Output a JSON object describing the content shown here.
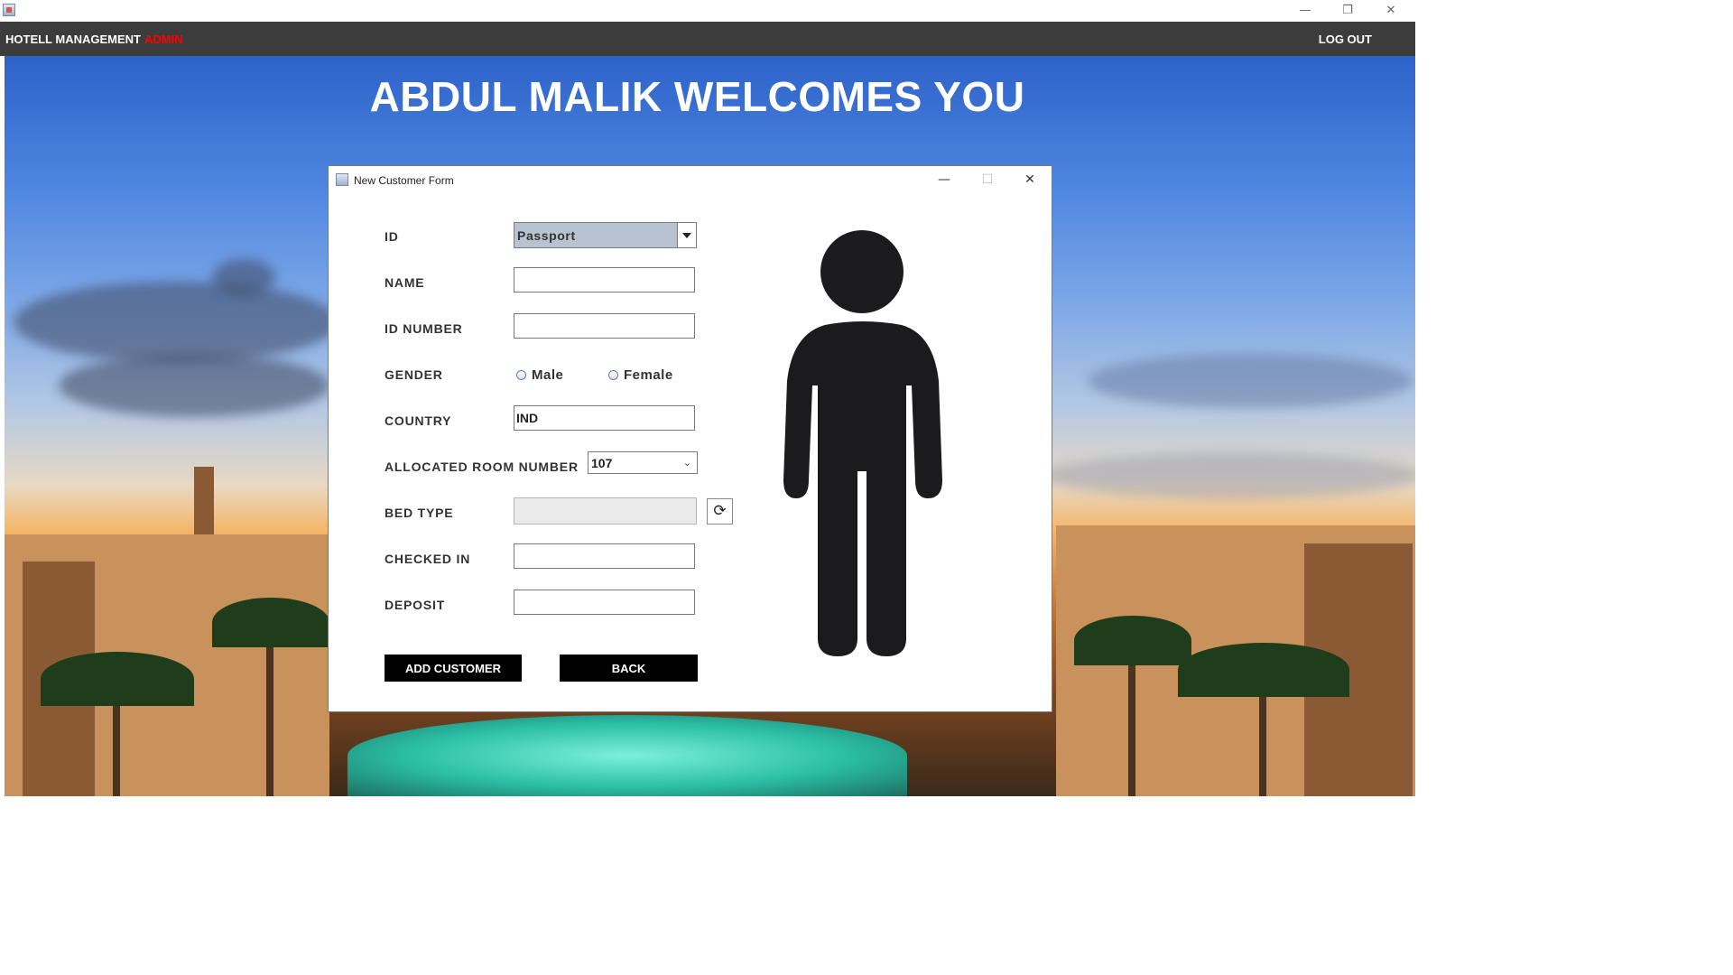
{
  "window": {
    "minimize_glyph": "—",
    "restore_glyph": "❐",
    "close_glyph": "✕"
  },
  "menubar": {
    "title": "HOTELL MANAGEMENT",
    "role": "ADMIN",
    "logout": "LOG OUT"
  },
  "banner": {
    "welcome": "ABDUL MALIK WELCOMES YOU"
  },
  "dialog": {
    "title": "New Customer Form",
    "minimize_glyph": "—",
    "maximize_glyph": "☐",
    "close_glyph": "✕"
  },
  "form": {
    "id_label": "ID",
    "id_value": "Passport",
    "name_label": "NAME",
    "name_value": "",
    "id_number_label": "ID NUMBER",
    "id_number_value": "",
    "gender_label": "GENDER",
    "gender_options": [
      "Male",
      "Female"
    ],
    "country_label": "COUNTRY",
    "country_value": "IND",
    "room_label": "ALLOCATED ROOM NUMBER",
    "room_value": "107",
    "bed_type_label": "BED TYPE",
    "bed_type_value": "",
    "checked_in_label": "CHECKED IN",
    "checked_in_value": "",
    "deposit_label": "DEPOSIT",
    "deposit_value": "",
    "add_button": "ADD CUSTOMER",
    "back_button": "BACK",
    "refresh_icon": "refresh-icon"
  },
  "colors": {
    "menubar_bg": "#3c3c3c",
    "admin_text": "#ff0000",
    "button_bg": "#000000",
    "combo_selected_bg": "#b8c3d1"
  }
}
